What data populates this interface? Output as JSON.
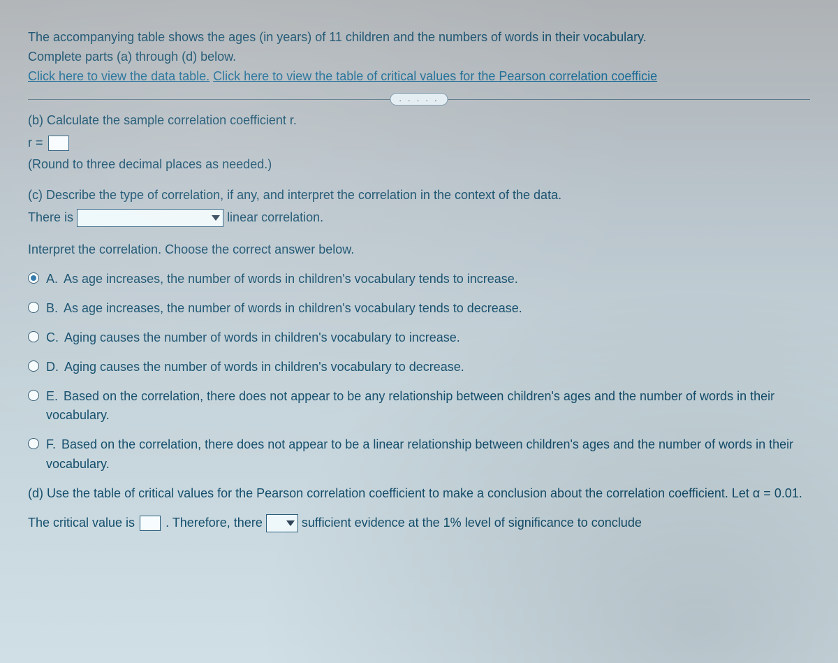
{
  "intro": {
    "line1": "The accompanying table shows the ages (in years) of 11 children and the numbers of words in their vocabulary.",
    "line2": "Complete parts (a) through (d) below.",
    "link1": "Click here to view the data table.",
    "link2": "Click here to view the table of critical values for the Pearson correlation coefficie"
  },
  "divider_dots": ". . . . .",
  "partB": {
    "prompt": "(b) Calculate the sample correlation coefficient r.",
    "r_prefix": "r =",
    "round_note": "(Round to three decimal places as needed.)"
  },
  "partC": {
    "prompt": "(c) Describe the type of correlation, if any, and interpret the correlation in the context of the data.",
    "sentence_prefix": "There is",
    "sentence_suffix": "linear correlation.",
    "interpret_prompt": "Interpret the correlation. Choose the correct answer below.",
    "options": [
      {
        "letter": "A.",
        "text": "As age increases, the number of words in children's vocabulary tends to increase.",
        "selected": true
      },
      {
        "letter": "B.",
        "text": "As age increases, the number of words in children's vocabulary tends to decrease.",
        "selected": false
      },
      {
        "letter": "C.",
        "text": "Aging causes the number of words in children's vocabulary to increase.",
        "selected": false
      },
      {
        "letter": "D.",
        "text": "Aging causes the number of words in children's vocabulary to decrease.",
        "selected": false
      },
      {
        "letter": "E.",
        "text": "Based on the correlation, there does not appear to be any relationship between children's ages and the number of words in their vocabulary.",
        "selected": false
      },
      {
        "letter": "F.",
        "text": "Based on the correlation, there does not appear to be a linear relationship between children's ages and the number of words in their vocabulary.",
        "selected": false
      }
    ]
  },
  "partD": {
    "prompt": "(d) Use the table of critical values for the Pearson correlation coefficient to make a conclusion about the correlation coefficient. Let α = 0.01.",
    "sentence_prefix": "The critical value is",
    "sentence_mid": ". Therefore, there",
    "sentence_suffix": "sufficient evidence at the 1% level of significance to conclude"
  }
}
